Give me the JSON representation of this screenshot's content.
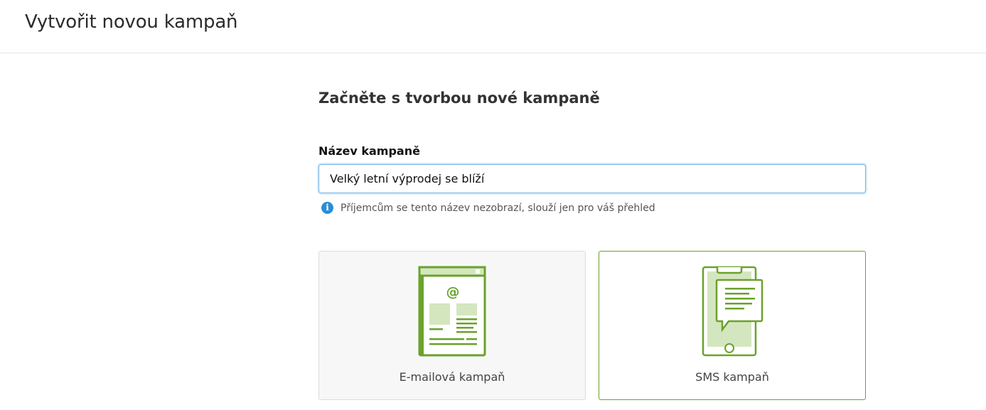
{
  "header": {
    "title": "Vytvořit novou kampaň"
  },
  "main": {
    "subheading": "Začněte s tvorbou nové kampaně",
    "campaign_name": {
      "label": "Název kampaně",
      "value": "Velký letní výprodej se blíží",
      "hint": "Příjemcům se tento název nezobrazí, slouží jen pro váš přehled",
      "hint_icon": "info-icon"
    },
    "campaign_types": [
      {
        "label": "E-mailová kampaň",
        "icon": "email-newsletter-icon",
        "selected": false
      },
      {
        "label": "SMS kampaň",
        "icon": "sms-phone-icon",
        "selected": true
      }
    ]
  },
  "colors": {
    "accent_green": "#6aa22b",
    "light_green": "#d4e6bf",
    "info_blue": "#2a8dd4",
    "focus_blue": "#6fb4e8"
  }
}
